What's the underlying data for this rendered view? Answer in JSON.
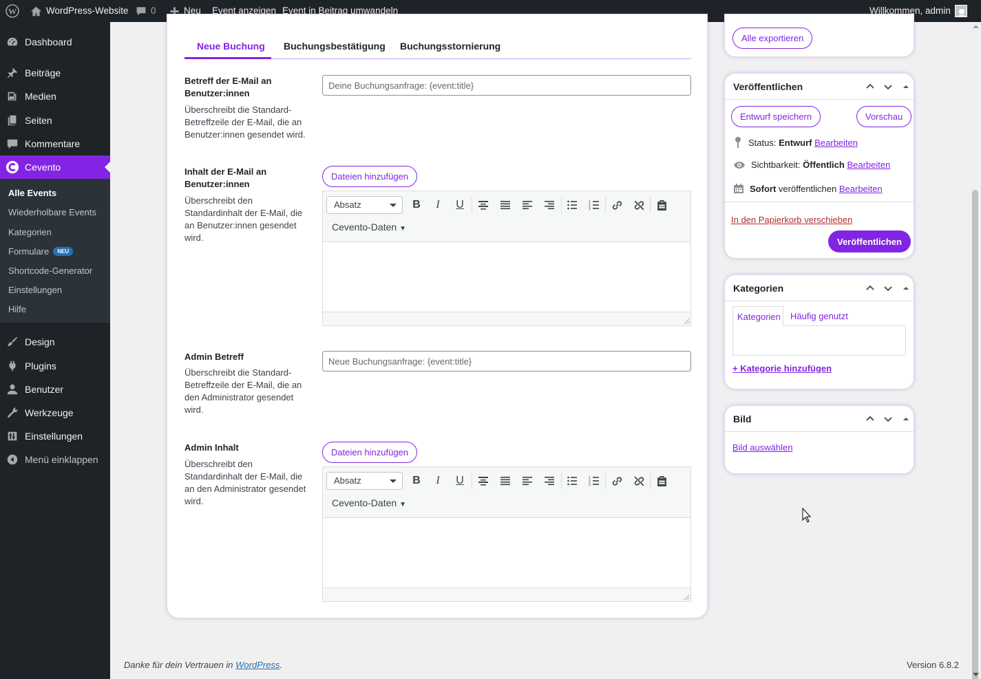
{
  "adminbar": {
    "site_name": "WordPress-Website",
    "comments_count": "0",
    "new_label": "Neu",
    "view_event": "Event anzeigen",
    "convert": "Event in Beitrag umwandeln",
    "greeting": "Willkommen, admin"
  },
  "sidebar": {
    "items": [
      {
        "label": "Dashboard",
        "icon": "dashboard-icon"
      },
      {
        "label": "Beiträge",
        "icon": "pin-icon"
      },
      {
        "label": "Medien",
        "icon": "media-icon"
      },
      {
        "label": "Seiten",
        "icon": "pages-icon"
      },
      {
        "label": "Kommentare",
        "icon": "comment-icon"
      },
      {
        "label": "Cevento",
        "icon": "cevento-icon"
      },
      {
        "label": "Design",
        "icon": "brush-icon"
      },
      {
        "label": "Plugins",
        "icon": "plugin-icon"
      },
      {
        "label": "Benutzer",
        "icon": "user-icon"
      },
      {
        "label": "Werkzeuge",
        "icon": "wrench-icon"
      },
      {
        "label": "Einstellungen",
        "icon": "settings-icon"
      },
      {
        "label": "Menü einklappen",
        "icon": "collapse-icon"
      }
    ],
    "submenu": [
      {
        "label": "Alle Events"
      },
      {
        "label": "Wiederholbare Events"
      },
      {
        "label": "Kategorien"
      },
      {
        "label": "Formulare",
        "badge": "NEU"
      },
      {
        "label": "Shortcode-Generator"
      },
      {
        "label": "Einstellungen"
      },
      {
        "label": "Hilfe"
      }
    ]
  },
  "tabs": [
    "Neue Buchung",
    "Buchungsbestätigung",
    "Buchungsstornierung"
  ],
  "fields": {
    "user_subject": {
      "label": "Betreff der E-Mail an Benutzer:innen",
      "desc": "Überschreibt die Standard-Betreffzeile der E-Mail, die an Benutzer:innen gesendet wird.",
      "placeholder": "Deine Buchungsanfrage: {event:title}"
    },
    "user_content": {
      "label": "Inhalt der E-Mail an Benutzer:innen",
      "desc": "Überschreibt den Standardinhalt der E-Mail, die an Benutzer:innen gesendet wird."
    },
    "admin_subject": {
      "label": "Admin Betreff",
      "desc": "Überschreibt die Standard-Betreffzeile der E-Mail, die an den Administrator gesendet wird.",
      "placeholder": "Neue Buchungsanfrage: {event:title}"
    },
    "admin_content": {
      "label": "Admin Inhalt",
      "desc": "Überschreibt den Standardinhalt der E-Mail, die an den Administrator gesendet wird."
    }
  },
  "editor": {
    "add_files": "Dateien hinzufügen",
    "format": "Absatz",
    "cevento_data": "Cevento-Daten",
    "toolbar_icons": [
      "bold-icon",
      "italic-icon",
      "underline-icon",
      "align-center-icon",
      "justify-icon",
      "align-left-icon",
      "align-right-icon",
      "bullet-list-icon",
      "numbered-list-icon",
      "link-icon",
      "unlink-icon",
      "paste-icon"
    ]
  },
  "export": {
    "label": "Alle exportieren"
  },
  "publish": {
    "title": "Veröffentlichen",
    "save_draft": "Entwurf speichern",
    "preview": "Vorschau",
    "status_label": "Status:",
    "status_value": "Entwurf",
    "visibility_label": "Sichtbarkeit:",
    "visibility_value": "Öffentlich",
    "schedule_value": "Sofort",
    "schedule_label": "veröffentlichen",
    "edit": "Bearbeiten",
    "trash": "In den Papierkorb verschieben",
    "publish_button": "Veröffentlichen"
  },
  "categories": {
    "title": "Kategorien",
    "tab_all": "Kategorien",
    "tab_popular": "Häufig genutzt",
    "add": "+ Kategorie hinzufügen"
  },
  "image": {
    "title": "Bild",
    "select": "Bild auswählen"
  },
  "footer": {
    "thanks_prefix": "Danke für dein Vertrauen in",
    "thanks_link": "WordPress",
    "thanks_suffix": ".",
    "version": "Version 6.8.2"
  },
  "colors": {
    "accent": "#8224e3",
    "sidebar": "#1d2327",
    "submenu": "#2c3338"
  }
}
